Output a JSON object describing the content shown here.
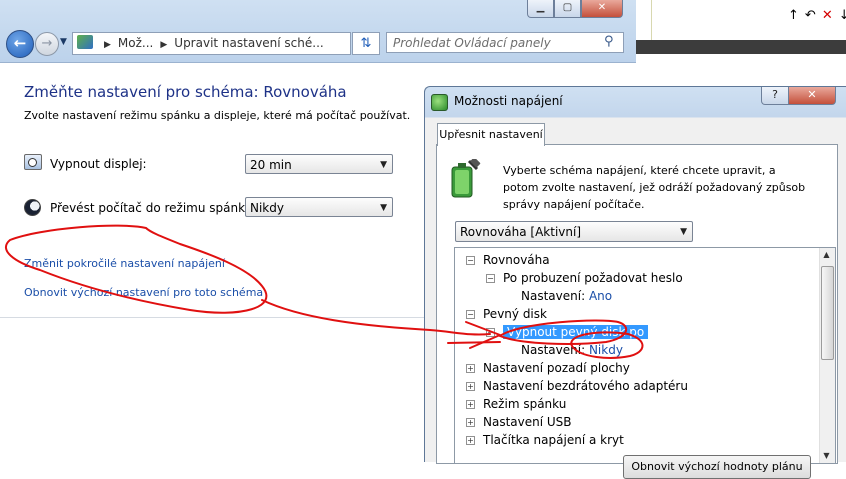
{
  "main_window": {
    "address_parts": [
      "Mož...",
      "Upravit nastavení sché..."
    ],
    "search_placeholder": "Prohledat Ovládací panely",
    "title": "Změňte nastavení pro schéma: Rovnováha",
    "subtitle": "Zvolte nastavení režimu spánku a displeje, které má počítač používat.",
    "display_label": "Vypnout displej:",
    "display_value": "20 min",
    "sleep_label": "Převést počítač do režimu spánku:",
    "sleep_value": "Nikdy",
    "link_advanced": "Změnit pokročilé nastavení napájení",
    "link_defaults": "Obnovit výchozí nastavení pro toto schéma"
  },
  "dialog": {
    "title": "Možnosti napájení",
    "help_label": "?",
    "tab_label": "Upřesnit nastavení",
    "description": "Vyberte schéma napájení, které chcete upravit, a potom zvolte nastavení, jež odráží požadovaný způsob správy napájení počítače.",
    "scheme_value": "Rovnováha [Aktivní]",
    "tree": [
      {
        "label": "Rovnováha",
        "toggle": "−"
      },
      {
        "label": "Po probuzení požadovat heslo",
        "toggle": "−"
      },
      {
        "label": "Nastavení:",
        "value": "Ano"
      },
      {
        "label": "Pevný disk",
        "toggle": "−"
      },
      {
        "label": "Vypnout pevný disk po",
        "toggle": "−"
      },
      {
        "label": "Nastavení:",
        "value": "Nikdy"
      },
      {
        "label": "Nastavení pozadí plochy",
        "toggle": "+"
      },
      {
        "label": "Nastavení bezdrátového adaptéru",
        "toggle": "+"
      },
      {
        "label": "Režim spánku",
        "toggle": "+"
      },
      {
        "label": "Nastavení USB",
        "toggle": "+"
      },
      {
        "label": "Tlačítka napájení a kryt",
        "toggle": "+"
      }
    ],
    "restore_button": "Obnovit výchozí hodnoty plánu"
  },
  "colors": {
    "annotation": "#e01010",
    "link": "#1a4ea8",
    "selection": "#3399ff",
    "title": "#1e3287"
  }
}
